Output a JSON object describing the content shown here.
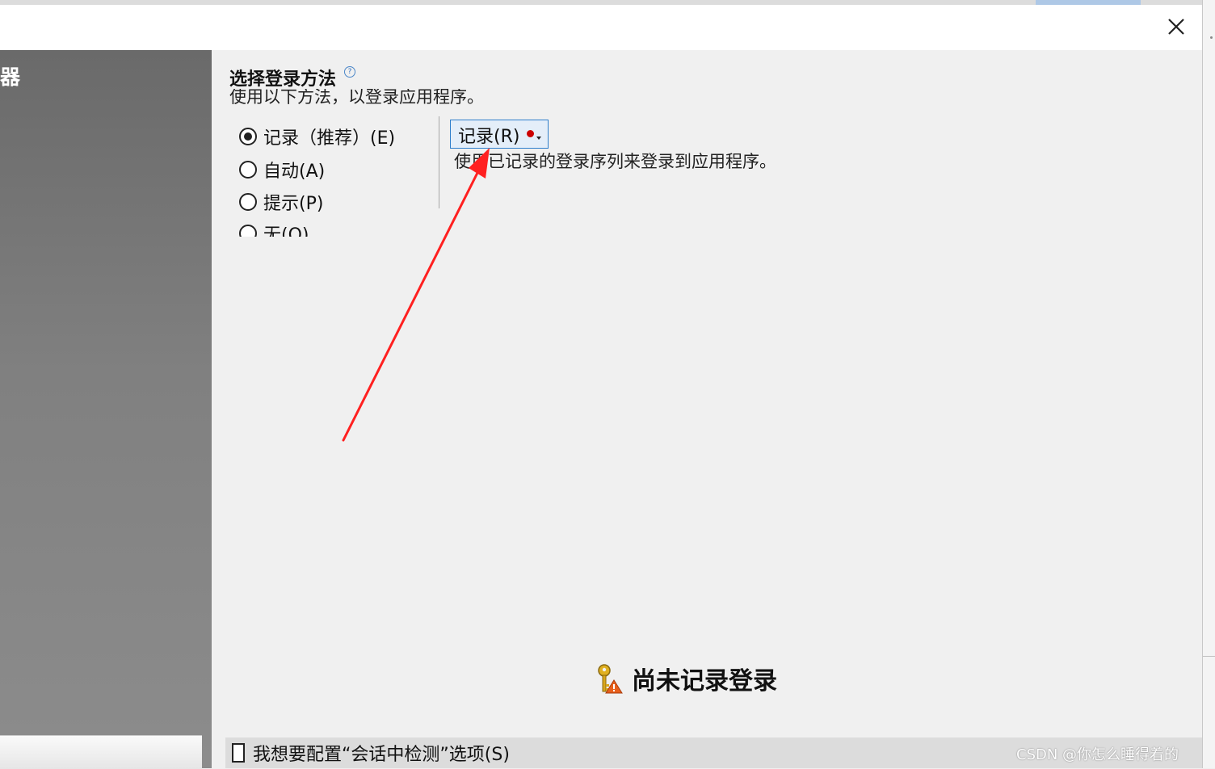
{
  "window": {
    "close_icon": "close-icon"
  },
  "sidebar": {
    "title": "器"
  },
  "login_method": {
    "heading": "选择登录方法",
    "help_icon": "help-icon",
    "help_symbol": "?",
    "description": "使用以下方法，以登录应用程序。",
    "options": [
      {
        "label": "记录（推荐）(E)",
        "selected": true
      },
      {
        "label": "自动(A)",
        "selected": false
      },
      {
        "label": "提示(P)",
        "selected": false
      },
      {
        "label": "无(O)",
        "selected": false
      }
    ]
  },
  "record_panel": {
    "button_label": "记录(R)",
    "button_indicator_color": "#cc0000",
    "description": "使用已记录的登录序列来登录到应用程序。"
  },
  "status": {
    "icon": "key-warning-icon",
    "text": "尚未记录登录"
  },
  "footer": {
    "checkbox_label": "我想要配置“会话中检测”选项(S)",
    "checkbox_checked": false
  },
  "annotation": {
    "arrow_color": "#ff2020"
  },
  "watermark": "CSDN @你怎么睡得着的"
}
